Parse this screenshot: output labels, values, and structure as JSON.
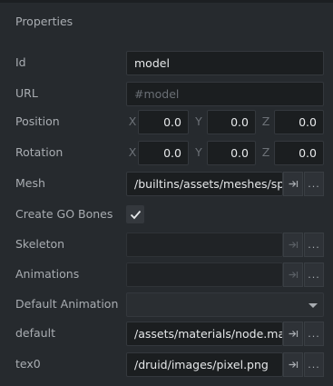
{
  "panel": {
    "title": "Properties"
  },
  "properties": {
    "id": {
      "label": "Id",
      "value": "model"
    },
    "url": {
      "label": "URL",
      "placeholder": "#model"
    },
    "position": {
      "label": "Position",
      "x_axis": "X",
      "y_axis": "Y",
      "z_axis": "Z",
      "x": "0.0",
      "y": "0.0",
      "z": "0.0"
    },
    "rotation": {
      "label": "Rotation",
      "x_axis": "X",
      "y_axis": "Y",
      "z_axis": "Z",
      "x": "0.0",
      "y": "0.0",
      "z": "0.0"
    },
    "mesh": {
      "label": "Mesh",
      "value": "/builtins/assets/meshes/sph",
      "more": "..."
    },
    "create_go_bones": {
      "label": "Create GO Bones",
      "checked": true
    },
    "skeleton": {
      "label": "Skeleton",
      "value": "",
      "more": "..."
    },
    "animations": {
      "label": "Animations",
      "value": "",
      "more": "..."
    },
    "default_animation": {
      "label": "Default Animation",
      "value": ""
    },
    "default": {
      "label": "default",
      "value": "/assets/materials/node.mate",
      "more": "..."
    },
    "tex0": {
      "label": "tex0",
      "value": "/druid/images/pixel.png",
      "more": "..."
    }
  },
  "icons": {
    "goto": "goto-resource-icon",
    "more": "browse-more-icon",
    "check": "checkmark-icon",
    "dropdown": "chevron-down-icon"
  },
  "colors": {
    "panel_bg": "#262a2e",
    "field_bg": "#1b1e20",
    "text": "#a9adb2",
    "value_text": "#e6e8ea",
    "placeholder_text": "#6a6f75"
  }
}
